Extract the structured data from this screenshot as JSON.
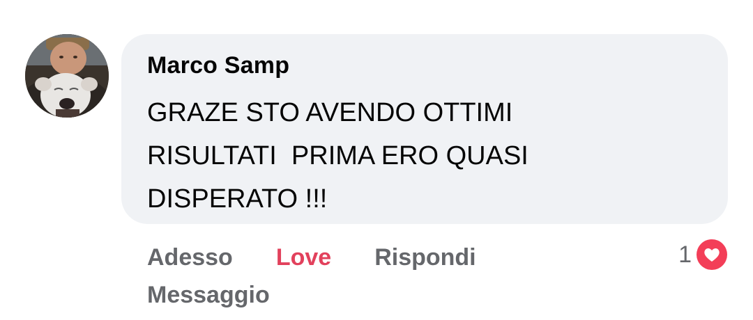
{
  "comment": {
    "author": "Marco Samp",
    "text": "GRAZE STO AVENDO OTTIMI\nRISULTATI  PRIMA ERO QUASI\nDISPERATO !!!",
    "avatar_icon": "profile-photo-man-with-white-dog"
  },
  "actions": {
    "timestamp": "Adesso",
    "love_label": "Love",
    "reply_label": "Rispondi",
    "message_label": "Messaggio"
  },
  "reactions": {
    "count": "1",
    "icon": "love-heart-icon"
  },
  "colors": {
    "bubble_bg": "#f0f2f5",
    "text": "#050505",
    "secondary": "#65676b",
    "love": "#e2415c"
  }
}
